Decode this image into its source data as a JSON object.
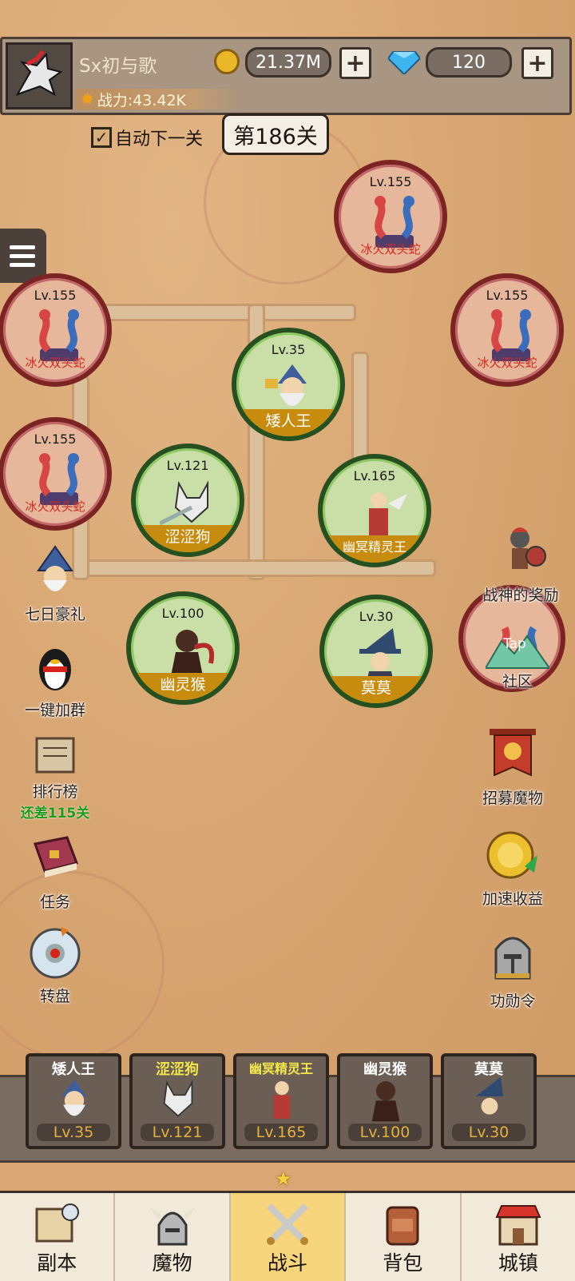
{
  "player": {
    "name": "Sx初与歌",
    "power_label": "战力:43.42K"
  },
  "currency": {
    "gold": "21.37M",
    "diamonds": "120",
    "plus": "+"
  },
  "controls": {
    "auto_next_label": "自动下一关",
    "auto_next_checked": true,
    "stage_label": "第186关"
  },
  "map_nodes": [
    {
      "level": "Lv.155",
      "name": "冰火双头蛇",
      "type": "enemy"
    },
    {
      "level": "Lv.155",
      "name": "冰火双头蛇",
      "type": "enemy"
    },
    {
      "level": "Lv.155",
      "name": "冰火双头蛇",
      "type": "enemy"
    },
    {
      "level": "Lv.155",
      "name": "冰火双头蛇",
      "type": "enemy"
    },
    {
      "level": "Lv.35",
      "name": "矮人王",
      "type": "ally"
    },
    {
      "level": "Lv.121",
      "name": "涩涩狗",
      "type": "ally"
    },
    {
      "level": "Lv.165",
      "name": "幽冥精灵王",
      "type": "ally"
    },
    {
      "level": "Lv.100",
      "name": "幽灵猴",
      "type": "ally"
    },
    {
      "level": "Lv.30",
      "name": "莫莫",
      "type": "ally"
    }
  ],
  "left_buttons": [
    {
      "label": "七日豪礼"
    },
    {
      "label": "一键加群"
    },
    {
      "label": "排行榜",
      "sub": "还差115关"
    },
    {
      "label": "任务"
    },
    {
      "label": "转盘"
    }
  ],
  "right_buttons": [
    {
      "label": "战神的奖励"
    },
    {
      "label": "社区",
      "tap": "Tap"
    },
    {
      "label": "招募魔物"
    },
    {
      "label": "加速收益"
    },
    {
      "label": "功勋令"
    }
  ],
  "squad": [
    {
      "name": "矮人王",
      "level": "Lv.35",
      "name_color": "#ffffff"
    },
    {
      "name": "涩涩狗",
      "level": "Lv.121",
      "name_color": "#f4e84a"
    },
    {
      "name": "幽冥精灵王",
      "level": "Lv.165",
      "name_color": "#f4e84a"
    },
    {
      "name": "幽灵猴",
      "level": "Lv.100",
      "name_color": "#ffffff"
    },
    {
      "name": "莫莫",
      "level": "Lv.30",
      "name_color": "#ffffff"
    }
  ],
  "nav": [
    {
      "label": "副本",
      "active": false
    },
    {
      "label": "魔物",
      "active": false
    },
    {
      "label": "战斗",
      "active": true
    },
    {
      "label": "背包",
      "active": false
    },
    {
      "label": "城镇",
      "active": false
    }
  ],
  "colors": {
    "enemy_ring": "#7c2423",
    "ally_ring": "#26501f",
    "ally_label_bg": "#c78b0e",
    "nav_active": "#f7d57d"
  }
}
